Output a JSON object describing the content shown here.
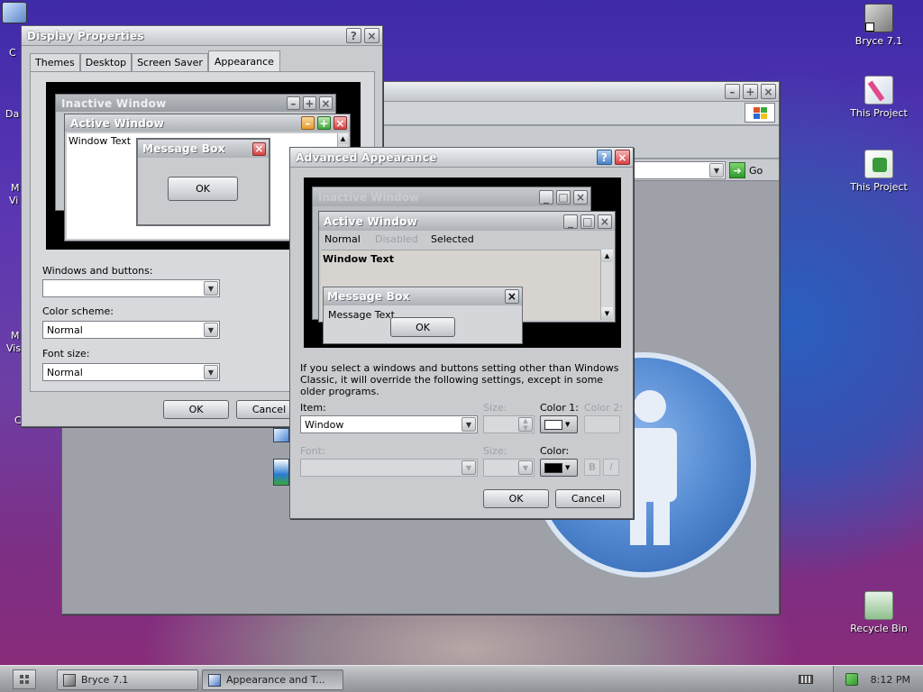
{
  "desktop": {
    "icons": [
      {
        "label": "Bryce 7.1",
        "icon": "bryce-icon"
      },
      {
        "label": "This Project",
        "icon": "paint-project-icon"
      },
      {
        "label": "This Project",
        "icon": "green-project-icon"
      },
      {
        "label": "Recycle Bin",
        "icon": "recycle-bin-icon"
      }
    ],
    "edge_labels": [
      "C",
      "Da",
      "M",
      "Vi",
      "M",
      "Vis",
      "C"
    ]
  },
  "explorer": {
    "go_label": "Go"
  },
  "display_properties": {
    "title": "Display Properties",
    "tabs": [
      "Themes",
      "Desktop",
      "Screen Saver",
      "Appearance"
    ],
    "active_tab": "Appearance",
    "preview": {
      "inactive_title": "Inactive Window",
      "active_title": "Active Window",
      "window_text": "Window Text",
      "message_box_title": "Message Box",
      "ok": "OK"
    },
    "windows_buttons_label": "Windows and buttons:",
    "windows_buttons_value": "",
    "color_scheme_label": "Color scheme:",
    "color_scheme_value": "Normal",
    "font_size_label": "Font size:",
    "font_size_value": "Normal",
    "ok": "OK",
    "cancel": "Cancel"
  },
  "advanced_appearance": {
    "title": "Advanced Appearance",
    "preview": {
      "inactive_title": "Inactive Window",
      "active_title": "Active Window",
      "menu_normal": "Normal",
      "menu_disabled": "Disabled",
      "menu_selected": "Selected",
      "window_text": "Window Text",
      "message_box_title": "Message Box",
      "message_text": "Message Text",
      "ok": "OK"
    },
    "info_text": "If you select a windows and buttons setting other than Windows Classic, it will override the following settings, except in some older programs.",
    "item_label": "Item:",
    "item_value": "Window",
    "size_label": "Size:",
    "color1_label": "Color 1:",
    "color2_label": "Color 2:",
    "font_label": "Font:",
    "size2_label": "Size:",
    "color_label": "Color:",
    "bold": "B",
    "italic": "I",
    "ok": "OK",
    "cancel": "Cancel",
    "color1_swatch": "#ffffff",
    "font_color_swatch": "#000000"
  },
  "taskbar": {
    "items": [
      {
        "label": "Bryce 7.1"
      },
      {
        "label": "Appearance and T..."
      }
    ],
    "clock": "8:12 PM"
  }
}
